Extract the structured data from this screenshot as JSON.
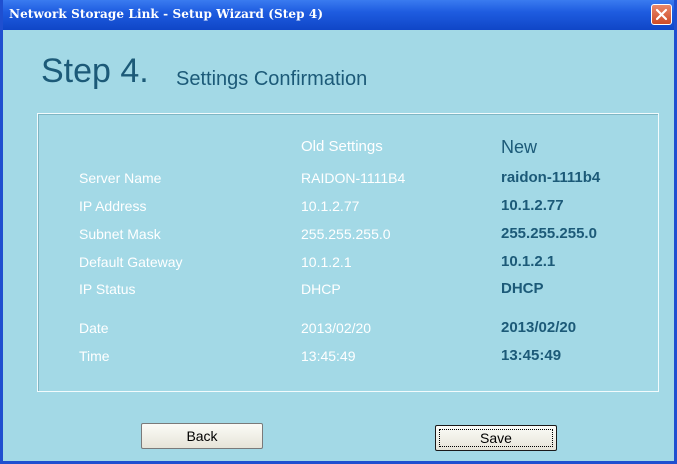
{
  "window": {
    "title": "Network Storage Link - Setup Wizard (Step 4)"
  },
  "header": {
    "step": "Step 4.",
    "title": "Settings Confirmation"
  },
  "table": {
    "col_old": "Old Settings",
    "col_new": "New",
    "rows": [
      {
        "label": "Server Name",
        "old": "RAIDON-1111B4",
        "new": "raidon-1111b4"
      },
      {
        "label": "IP Address",
        "old": "10.1.2.77",
        "new": "10.1.2.77"
      },
      {
        "label": "Subnet Mask",
        "old": "255.255.255.0",
        "new": "255.255.255.0"
      },
      {
        "label": "Default Gateway",
        "old": "10.1.2.1",
        "new": "10.1.2.1"
      },
      {
        "label": "IP Status",
        "old": "DHCP",
        "new": "DHCP"
      },
      {
        "label": "Date",
        "old": "2013/02/20",
        "new": "2013/02/20"
      },
      {
        "label": "Time",
        "old": "13:45:49",
        "new": "13:45:49"
      }
    ]
  },
  "buttons": {
    "back": "Back",
    "save": "Save"
  },
  "colors": {
    "background": "#a3d9e6",
    "heading": "#1c5a78",
    "titlebar": "#1e5ce0"
  }
}
